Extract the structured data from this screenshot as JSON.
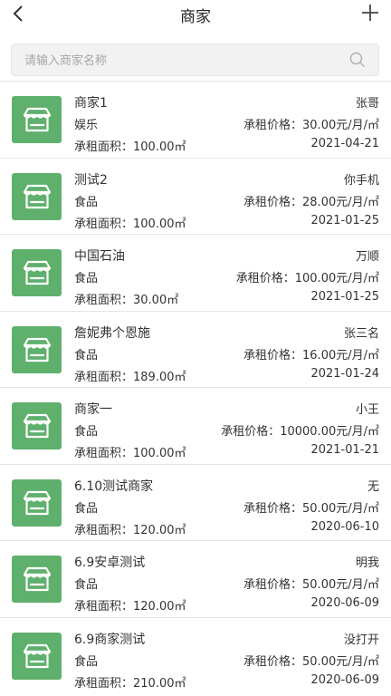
{
  "header": {
    "title": "商家",
    "back_icon": "chevron-left-icon",
    "add_icon": "plus-icon"
  },
  "search": {
    "placeholder": "请输入商家名称",
    "value": "",
    "icon": "search-icon"
  },
  "colors": {
    "thumb_bg": "#5fb06c",
    "divider": "#e5e5e5"
  },
  "merchants": [
    {
      "name": "商家1",
      "owner": "张哥",
      "category": "娱乐",
      "price": "承租价格：30.00元/月/㎡",
      "area": "承租面积：100.00㎡",
      "date": "2021-04-21"
    },
    {
      "name": "测试2",
      "owner": "你手机",
      "category": "食品",
      "price": "承租价格：28.00元/月/㎡",
      "area": "承租面积：100.00㎡",
      "date": "2021-01-25"
    },
    {
      "name": "中国石油",
      "owner": "万顺",
      "category": "食品",
      "price": "承租价格：100.00元/月/㎡",
      "area": "承租面积：30.00㎡",
      "date": "2021-01-25"
    },
    {
      "name": "詹妮弗个恩施",
      "owner": "张三名",
      "category": "食品",
      "price": "承租价格：16.00元/月/㎡",
      "area": "承租面积：189.00㎡",
      "date": "2021-01-24"
    },
    {
      "name": "商家一",
      "owner": "小王",
      "category": "食品",
      "price": "承租价格：10000.00元/月/㎡",
      "area": "承租面积：100.00㎡",
      "date": "2021-01-21"
    },
    {
      "name": "6.10测试商家",
      "owner": "无",
      "category": "食品",
      "price": "承租价格：50.00元/月/㎡",
      "area": "承租面积：120.00㎡",
      "date": "2020-06-10"
    },
    {
      "name": "6.9安卓测试",
      "owner": "明我",
      "category": "食品",
      "price": "承租价格：50.00元/月/㎡",
      "area": "承租面积：120.00㎡",
      "date": "2020-06-09"
    },
    {
      "name": "6.9商家测试",
      "owner": "没打开",
      "category": "食品",
      "price": "承租价格：50.00元/月/㎡",
      "area": "承租面积：210.00㎡",
      "date": "2020-06-09"
    }
  ]
}
